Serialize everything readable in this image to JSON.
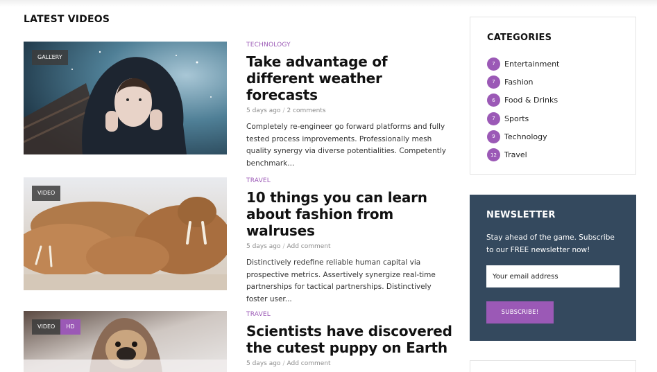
{
  "section_title": "LATEST VIDEOS",
  "posts": [
    {
      "tags": [
        "GALLERY"
      ],
      "category": "TECHNOLOGY",
      "title": "Take advantage of different weather forecasts",
      "date": "5 days ago",
      "comments": "2 comments",
      "excerpt": "Completely re-engineer go forward platforms and fully tested process improvements. Professionally mesh quality synergy via diverse potentialities. Competently benchmark..."
    },
    {
      "tags": [
        "VIDEO"
      ],
      "category": "TRAVEL",
      "title": "10 things you can learn about fashion from walruses",
      "date": "5 days ago",
      "comments": "Add comment",
      "excerpt": "Distinctively redefine reliable human capital via prospective metrics. Assertively synergize real-time partnerships for tactical partnerships. Distinctively foster user..."
    },
    {
      "tags": [
        "VIDEO",
        "HD"
      ],
      "category": "TRAVEL",
      "title": "Scientists have discovered the cutest puppy on Earth",
      "date": "5 days ago",
      "comments": "Add comment",
      "excerpt": ""
    }
  ],
  "categories": {
    "heading": "CATEGORIES",
    "items": [
      {
        "count": "7",
        "label": "Entertainment"
      },
      {
        "count": "7",
        "label": "Fashion"
      },
      {
        "count": "6",
        "label": "Food & Drinks"
      },
      {
        "count": "7",
        "label": "Sports"
      },
      {
        "count": "9",
        "label": "Technology"
      },
      {
        "count": "12",
        "label": "Travel"
      }
    ]
  },
  "newsletter": {
    "heading": "NEWSLETTER",
    "text": "Stay ahead of the game. Subscribe to our FREE newsletter now!",
    "placeholder": "Your email address",
    "button": "SUBSCRIBE!"
  },
  "colors": {
    "accent": "#9b59b6",
    "newsletter_bg": "#34495e"
  }
}
